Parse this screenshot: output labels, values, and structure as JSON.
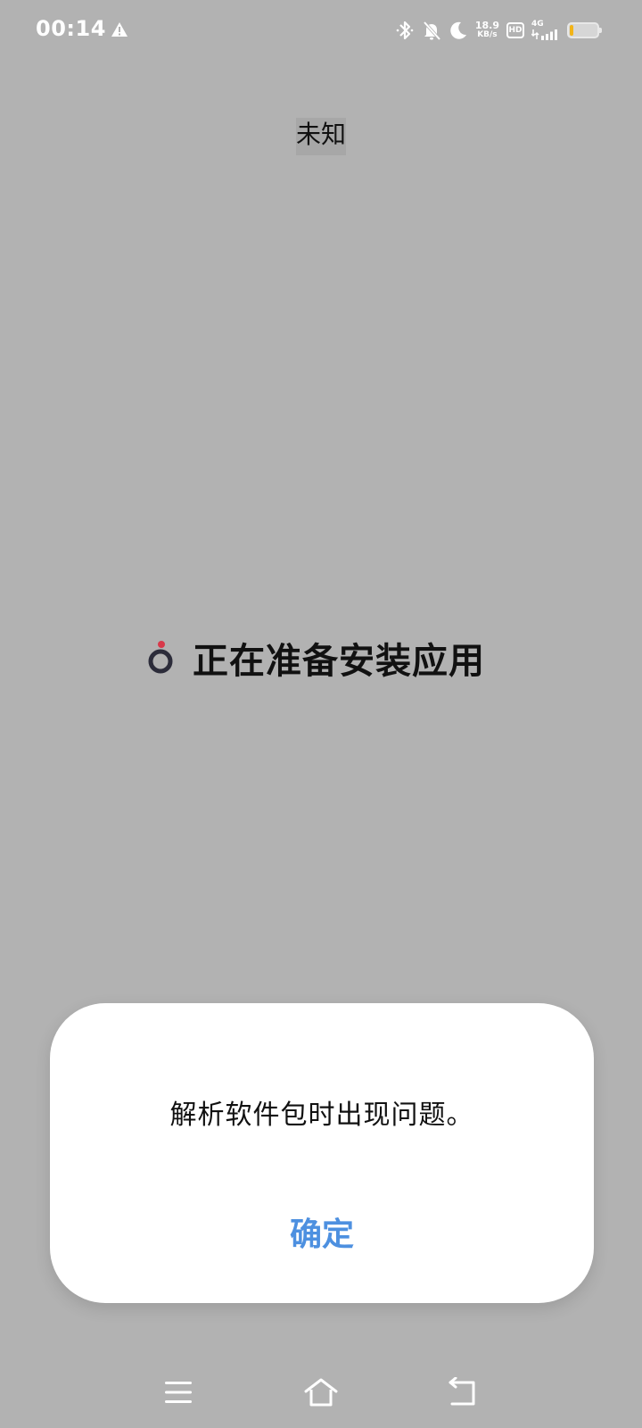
{
  "status_bar": {
    "time": "00:14",
    "speed_value": "18.9",
    "speed_unit": "KB/s",
    "hd_label": "HD",
    "network_label": "4G",
    "battery_level": 0.12,
    "icons": [
      "warning-icon",
      "bluetooth-icon",
      "mute-icon",
      "moon-icon",
      "signal-icon",
      "battery-icon"
    ]
  },
  "header": {
    "title": "未知"
  },
  "main": {
    "status_text": "正在准备安装应用"
  },
  "dialog": {
    "message": "解析软件包时出现问题。",
    "confirm_label": "确定"
  },
  "nav_bar": {
    "icons": [
      "menu-icon",
      "home-icon",
      "back-icon"
    ]
  },
  "colors": {
    "background": "#b2b2b2",
    "accent": "#4d90e0",
    "spinner_dot": "#d8394a",
    "spinner_ring": "#2c2c3a",
    "battery": "#f2b418"
  }
}
